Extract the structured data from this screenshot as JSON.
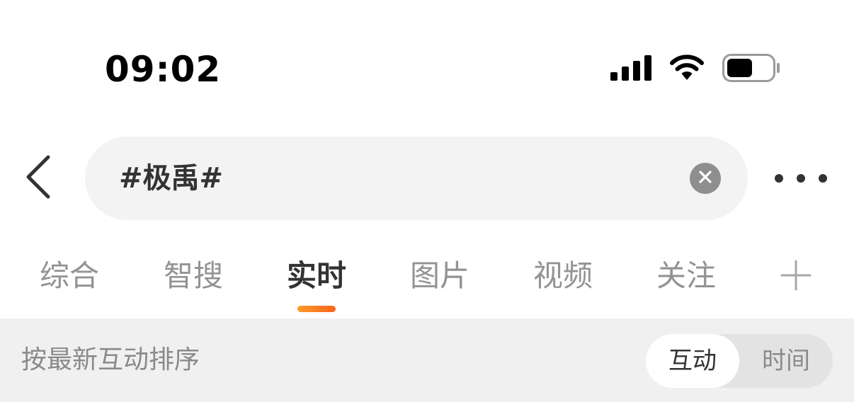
{
  "status_bar": {
    "time": "09:02",
    "icons": [
      "cellular-signal-icon",
      "wifi-icon",
      "battery-icon"
    ]
  },
  "search": {
    "query": "#极禹#",
    "clear_icon": "clear-icon",
    "back_icon": "chevron-left-icon",
    "more_icon": "more-dots-icon"
  },
  "tabs": [
    {
      "label": "综合",
      "active": false
    },
    {
      "label": "智搜",
      "active": false
    },
    {
      "label": "实时",
      "active": true
    },
    {
      "label": "图片",
      "active": false
    },
    {
      "label": "视频",
      "active": false
    },
    {
      "label": "关注",
      "active": false
    }
  ],
  "tab_add_icon": "plus-icon",
  "sort_bar": {
    "label": "按最新互动排序",
    "options": [
      {
        "label": "互动",
        "active": true
      },
      {
        "label": "时间",
        "active": false
      }
    ]
  },
  "colors": {
    "accent": "#ff8a1f",
    "text_primary": "#333333",
    "text_secondary": "#939393",
    "search_bg": "#f3f3f3",
    "sort_bg": "#f0f0f0"
  }
}
